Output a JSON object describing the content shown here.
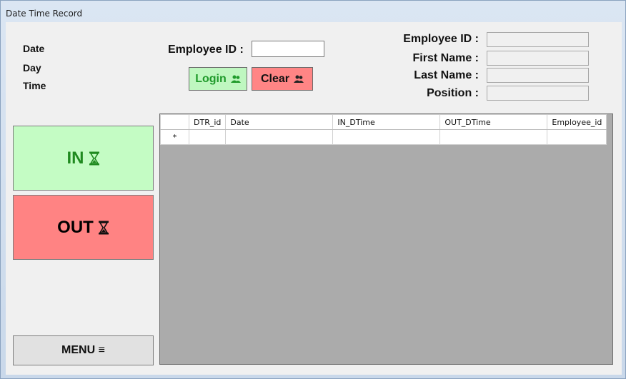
{
  "window": {
    "title": "Date Time Record"
  },
  "info_labels": {
    "date": "Date",
    "day": "Day",
    "time": "Time"
  },
  "login": {
    "employee_id_label": "Employee ID :",
    "employee_id_value": "",
    "login_label": "Login",
    "clear_label": "Clear"
  },
  "details": {
    "employee_id_label": "Employee ID :",
    "first_name_label": "First Name :",
    "last_name_label": "Last Name :",
    "position_label": "Position :"
  },
  "actions": {
    "in_label": "IN",
    "out_label": "OUT",
    "menu_label": "MENU ≡"
  },
  "grid": {
    "columns": [
      "DTR_id",
      "Date",
      "IN_DTime",
      "OUT_DTime",
      "Employee_id"
    ],
    "new_row_marker": "*"
  },
  "colors": {
    "login_bg": "#bff7c0",
    "clear_bg": "#ff8585",
    "in_bg": "#c4fcc4",
    "out_bg": "#ff8383",
    "grid_bg": "#ababab"
  },
  "icons": {
    "login": "users-icon",
    "clear": "users-icon",
    "in": "hourglass-icon",
    "out": "hourglass-icon",
    "menu": "hamburger-icon"
  }
}
